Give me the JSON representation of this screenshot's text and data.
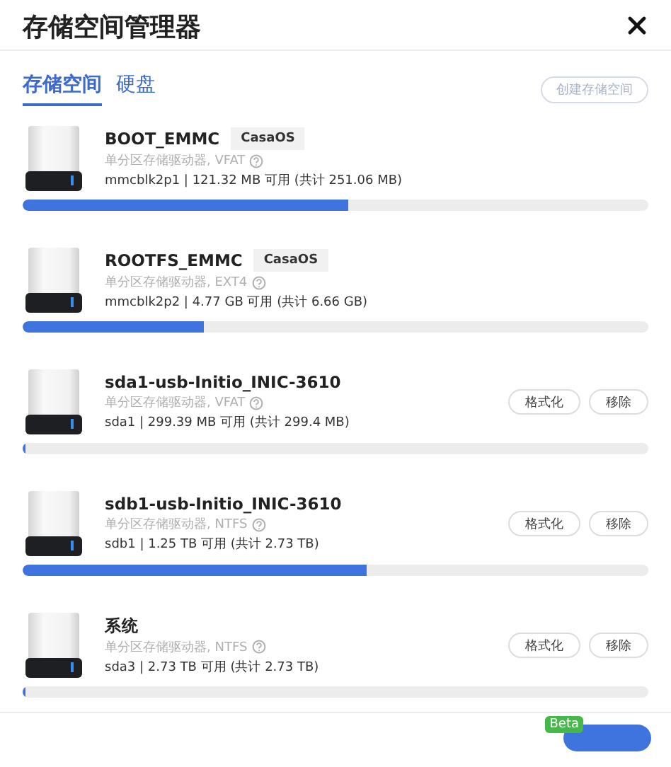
{
  "window": {
    "title": "存储空间管理器"
  },
  "tabs": [
    {
      "label": "存储空间",
      "selected": true
    },
    {
      "label": "硬盘",
      "selected": false
    }
  ],
  "create_button": {
    "label": "创建存储空间",
    "disabled": true
  },
  "volumes": [
    {
      "name": "BOOT_EMMC",
      "tag": "CasaOS",
      "description": "单分区存储驱动器, VFAT",
      "usage": "mmcblk2p1 | 121.32 MB 可用 (共计 251.06 MB)",
      "level": 0.52
    },
    {
      "name": "ROOTFS_EMMC",
      "tag": "CasaOS",
      "description": "单分区存储驱动器, EXT4",
      "usage": "mmcblk2p2 | 4.77 GB 可用 (共计 6.66 GB)",
      "level": 0.29
    },
    {
      "name": "sda1-usb-Initio_INIC-3610",
      "description": "单分区存储驱动器, VFAT",
      "usage": "sda1 | 299.39 MB 可用 (共计 299.4 MB)",
      "level": 0.005,
      "actions": [
        "格式化",
        "移除"
      ]
    },
    {
      "name": "sdb1-usb-Initio_INIC-3610",
      "description": "单分区存储驱动器, NTFS",
      "usage": "sdb1 | 1.25 TB 可用 (共计 2.73 TB)",
      "level": 0.55,
      "actions": [
        "格式化",
        "移除"
      ]
    },
    {
      "name": "系统",
      "description": "单分区存储驱动器, NTFS",
      "usage": "sda3 | 2.73 TB 可用 (共计 2.73 TB)",
      "level": 0.005,
      "actions": [
        "格式化",
        "移除"
      ]
    }
  ],
  "footer": {
    "badge": "Beta"
  }
}
